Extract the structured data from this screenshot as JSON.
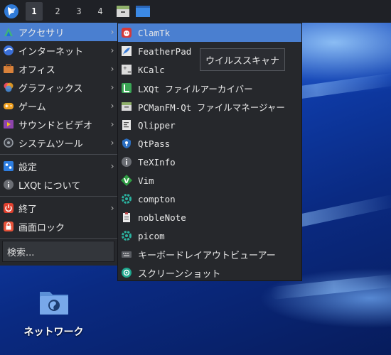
{
  "panel": {
    "workspaces": [
      "1",
      "2",
      "3",
      "4"
    ],
    "active_workspace": "1"
  },
  "menu": {
    "items": [
      {
        "label": "アクセサリ",
        "icon": "accessories-icon",
        "submenu": true,
        "highlight": true
      },
      {
        "label": "インターネット",
        "icon": "internet-icon",
        "submenu": true
      },
      {
        "label": "オフィス",
        "icon": "office-icon",
        "submenu": true
      },
      {
        "label": "グラフィックス",
        "icon": "graphics-icon",
        "submenu": true
      },
      {
        "label": "ゲーム",
        "icon": "games-icon",
        "submenu": true
      },
      {
        "label": "サウンドとビデオ",
        "icon": "multimedia-icon",
        "submenu": true
      },
      {
        "label": "システムツール",
        "icon": "system-tools-icon",
        "submenu": true
      },
      {
        "label": "設定",
        "icon": "settings-icon",
        "submenu": true
      },
      {
        "label": "LXQt について",
        "icon": "info-icon",
        "submenu": false
      },
      {
        "label": "終了",
        "icon": "power-icon",
        "submenu": true
      },
      {
        "label": "画面ロック",
        "icon": "lock-icon",
        "submenu": false
      }
    ],
    "search_label": "検索..."
  },
  "submenu": {
    "items": [
      {
        "label": "ClamTk",
        "icon": "clamtk-icon",
        "highlight": true
      },
      {
        "label": "FeatherPad",
        "icon": "featherpad-icon"
      },
      {
        "label": "KCalc",
        "icon": "kcalc-icon"
      },
      {
        "label": "LXQt ファイルアーカイバー",
        "icon": "archiver-icon"
      },
      {
        "label": "PCManFM-Qt ファイルマネージャー",
        "icon": "file-manager-icon"
      },
      {
        "label": "Qlipper",
        "icon": "clipboard-icon"
      },
      {
        "label": "QtPass",
        "icon": "qtpass-icon"
      },
      {
        "label": "TeXInfo",
        "icon": "texinfo-icon"
      },
      {
        "label": "Vim",
        "icon": "vim-icon"
      },
      {
        "label": "compton",
        "icon": "compton-icon"
      },
      {
        "label": "nobleNote",
        "icon": "noblenote-icon"
      },
      {
        "label": "picom",
        "icon": "picom-icon"
      },
      {
        "label": "キーボードレイアウトビューアー",
        "icon": "keyboard-icon"
      },
      {
        "label": "スクリーンショット",
        "icon": "screenshot-icon"
      }
    ]
  },
  "tooltip": {
    "text": "ウイルススキャナ"
  },
  "desktop": {
    "icon_label": "ネットワーク"
  },
  "colors": {
    "highlight": "#4a7fd0",
    "menu_bg": "#26282c",
    "panel_bg": "#1f2126"
  }
}
